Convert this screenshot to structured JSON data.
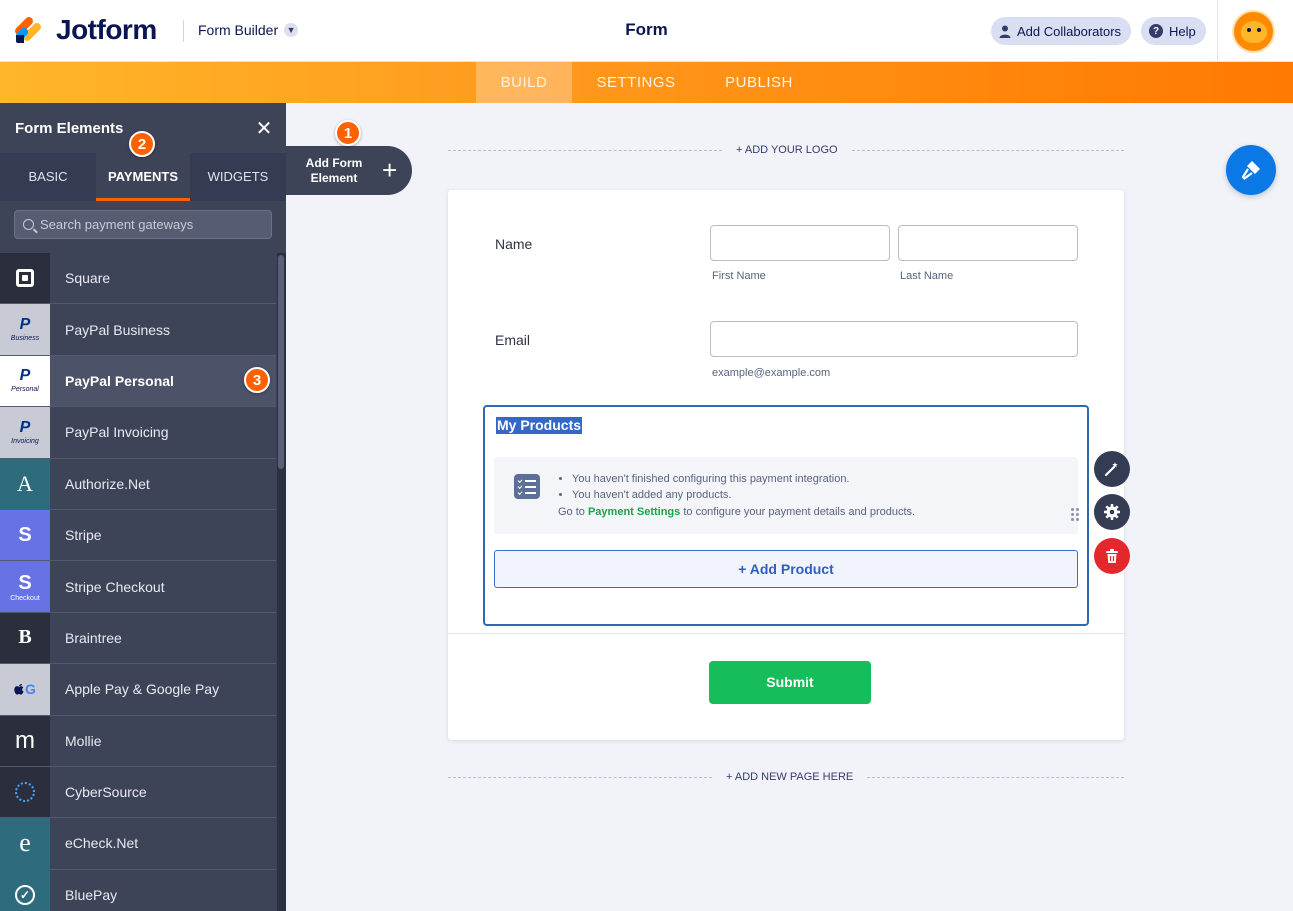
{
  "header": {
    "brand": "Jotform",
    "builder_select": "Form Builder",
    "title": "Form",
    "collaborators_label": "Add Collaborators",
    "help_label": "Help"
  },
  "tabs": {
    "build": "BUILD",
    "settings": "SETTINGS",
    "publish": "PUBLISH",
    "active": "BUILD"
  },
  "panel": {
    "title": "Form Elements",
    "close_glyph": "✕",
    "tabs": [
      "BASIC",
      "PAYMENTS",
      "WIDGETS"
    ],
    "active_tab": "PAYMENTS",
    "search_placeholder": "Search payment gateways",
    "gateways": [
      {
        "name": "Square",
        "icon": "square-icon"
      },
      {
        "name": "PayPal Business",
        "icon": "paypal-icon",
        "icon_caption": "Business"
      },
      {
        "name": "PayPal Personal",
        "icon": "paypal-icon",
        "icon_caption": "Personal"
      },
      {
        "name": "PayPal Invoicing",
        "icon": "paypal-icon",
        "icon_caption": "Invoicing"
      },
      {
        "name": "Authorize.Net",
        "icon": "authorize-net-icon",
        "icon_letter": "A"
      },
      {
        "name": "Stripe",
        "icon": "stripe-icon",
        "icon_letter": "S"
      },
      {
        "name": "Stripe Checkout",
        "icon": "stripe-icon",
        "icon_letter": "S",
        "icon_caption": "Checkout"
      },
      {
        "name": "Braintree",
        "icon": "braintree-icon",
        "icon_letter": "B"
      },
      {
        "name": "Apple Pay & Google Pay",
        "icon": "apple-google-pay-icon",
        "icon_letter": "G"
      },
      {
        "name": "Mollie",
        "icon": "mollie-icon",
        "icon_letter": "m"
      },
      {
        "name": "CyberSource",
        "icon": "cybersource-icon"
      },
      {
        "name": "eCheck.Net",
        "icon": "echeck-icon",
        "icon_letter": "e"
      },
      {
        "name": "BluePay",
        "icon": "bluepay-icon"
      }
    ],
    "highlighted_gateway": "PayPal Personal"
  },
  "add_element": {
    "label": "Add Form Element",
    "plus": "+"
  },
  "steps": [
    "1",
    "2",
    "3"
  ],
  "canvas": {
    "add_logo": "+ ADD YOUR LOGO",
    "add_page": "+ ADD NEW PAGE HERE"
  },
  "form": {
    "name_label": "Name",
    "first_name_sub": "First Name",
    "last_name_sub": "Last Name",
    "email_label": "Email",
    "email_sub": "example@example.com",
    "products_title": "My Products",
    "notice_items": [
      "You haven't finished configuring this payment integration.",
      "You haven't added any products."
    ],
    "goto_prefix": "Go to ",
    "goto_link": "Payment Settings",
    "goto_suffix": " to configure your payment details and products.",
    "add_product": "+ Add Product",
    "submit": "Submit"
  },
  "colors": {
    "accent_orange": "#ff6100",
    "submit_green": "#18bd5b",
    "selection_blue": "#2e69b6",
    "delete_red": "#e3272d",
    "designer_blue": "#0a79e6"
  }
}
